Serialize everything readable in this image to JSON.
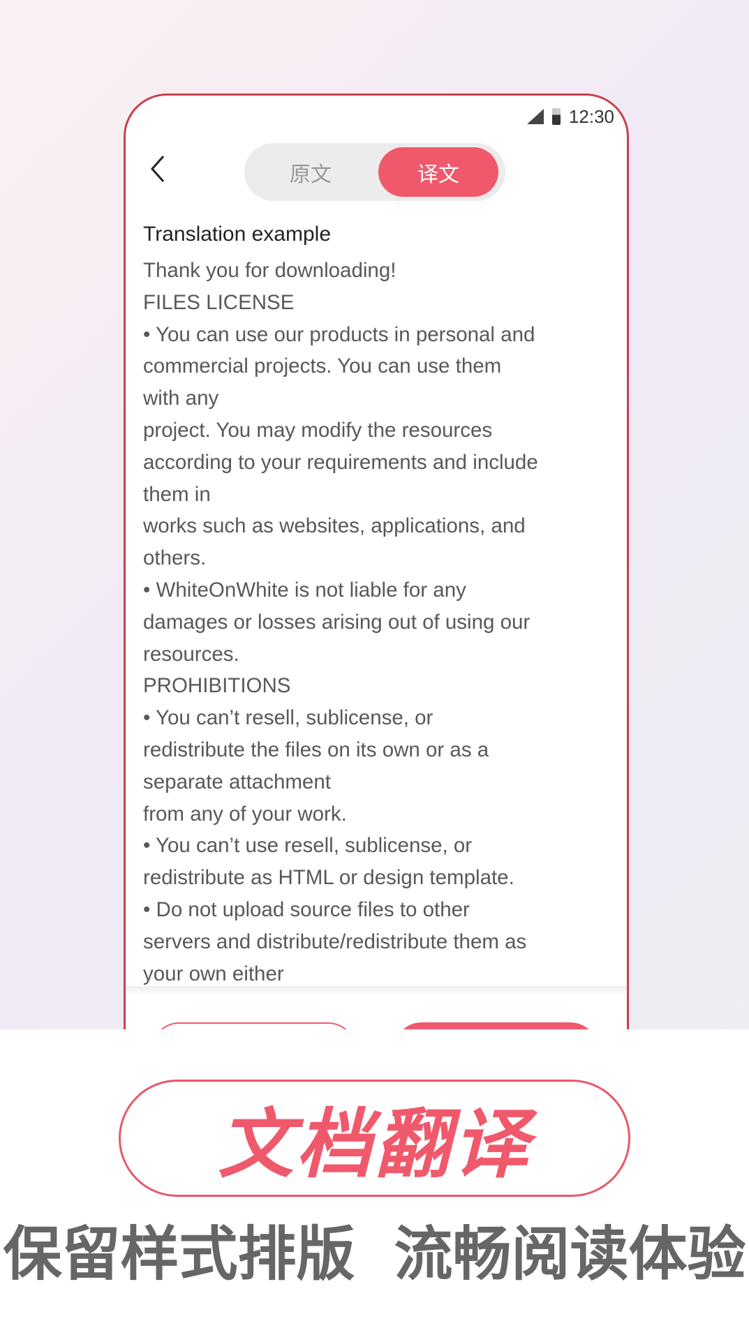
{
  "status_bar": {
    "time": "12:30",
    "signal_icon": "signal-icon",
    "battery_icon": "battery-icon"
  },
  "header": {
    "back_icon": "chevron-left-icon",
    "tabs": [
      {
        "label": "原文",
        "active": false
      },
      {
        "label": "译文",
        "active": true
      }
    ]
  },
  "colors": {
    "accent": "#f0596b",
    "frame": "#c8414d",
    "subtitle": "#666666"
  },
  "document": {
    "title": "Translation example",
    "lines": [
      "Thank you for downloading!",
      "FILES LICENSE",
      "• You can use our products in personal and",
      "commercial projects. You can use them",
      "with any",
      "project. You may modify the resources",
      "according to your requirements and include",
      "them in",
      "works such as websites, applications, and",
      "others.",
      "• WhiteOnWhite is not liable for any",
      "damages or losses arising out of using our",
      "resources.",
      "PROHIBITIONS",
      "• You can’t resell, sublicense, or",
      "redistribute the files on its own or as a",
      "separate attachment",
      "from any of your work.",
      "• You can’t use resell, sublicense, or",
      "redistribute as HTML or design template.",
      "• Do not upload source files to other",
      "servers and distribute/redistribute them as",
      "your own either"
    ]
  },
  "promo": {
    "headline": "文档翻译",
    "subtitle_left": "保留样式排版",
    "subtitle_right": "流畅阅读体验"
  }
}
